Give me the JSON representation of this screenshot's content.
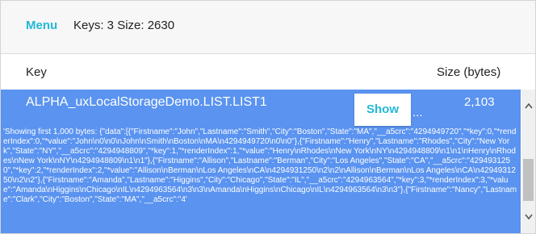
{
  "toolbar": {
    "menu_label": "Menu",
    "stats": "Keys: 3 Size: 2630"
  },
  "table": {
    "headers": {
      "key": "Key",
      "size": "Size (bytes)"
    },
    "rows": [
      {
        "key": "ALPHA_uxLocalStorageDemo.LIST.LIST1",
        "size": "2,103",
        "show_label": "Show",
        "ellipsis": "...",
        "preview": "'Showing first 1,000 bytes: {\"data\":[{\"Firstname\":\"John\",\"Lastname\":\"Smith\",\"City\":\"Boston\",\"State\":\"MA\",\"__a5crc\":\"4294949720\",\"*key\":0,\"*renderIndex\":0,\"*value\":\"John\\n0\\n0\\nJohn\\nSmith\\nBoston\\nMA\\n4294949720\\n0\\n0\"},{\"Firstname\":\"Henry\",\"Lastname\":\"Rhodes\",\"City\":\"New York\",\"State\":\"NY\",\"__a5crc\":\"4294948809\",\"*key\":1,\"*renderIndex\":1,\"*value\":\"Henry\\nRhodes\\nNew York\\nNY\\n4294948809\\n1\\n1\\nHenry\\nRhodes\\nNew York\\nNY\\n4294948809\\n1\\n1\"},{\"Firstname\":\"Allison\",\"Lastname\":\"Berman\",\"City\":\"Los Angeles\",\"State\":\"CA\",\"__a5crc\":\"4294931250\",\"*key\":2,\"*renderIndex\":2,\"*value\":\"Allison\\nBerman\\nLos Angeles\\nCA\\n4294931250\\n2\\n2\\nAllison\\nBerman\\nLos Angeles\\nCA\\n4294931250\\n2\\n2\"},{\"Firstname\":\"Amanda\",\"Lastname\":\"Higgins\",\"City\":\"Chicago\",\"State\":\"IL\",\"__a5crc\":\"4294963564\",\"*key\":3,\"*renderIndex\":3,\"*value\":\"Amanda\\nHiggins\\nChicago\\nIL\\n4294963564\\n3\\n3\\nAmanda\\nHiggins\\nChicago\\nIL\\n4294963564\\n3\\n3\"},{\"Firstname\":\"Nancy\",\"Lastname\":\"Clark\",\"City\":\"Boston\",\"State\":\"MA\",\"__a5crc\":\"4'"
      }
    ]
  },
  "scrollbar": {
    "up_icon": "chevron-up-icon",
    "down_icon": "chevron-down-icon"
  },
  "colors": {
    "accent": "#22b8d6",
    "selected_row": "#5a93f0"
  }
}
